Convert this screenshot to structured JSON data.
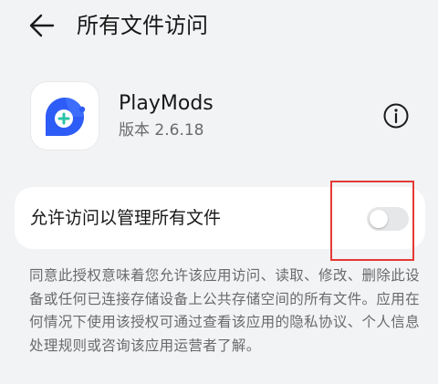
{
  "header": {
    "title": "所有文件访问",
    "back_icon": "arrow-left-icon"
  },
  "app": {
    "name": "PlayMods",
    "version": "版本 2.6.18",
    "icon": "playmods-logo",
    "info_icon": "info-circle-icon"
  },
  "setting": {
    "label": "允许访问以管理所有文件",
    "enabled": false
  },
  "description": "同意此授权意味着您允许该应用访问、读取、修改、删除此设备或任何已连接存储设备上公共存储空间的所有文件。应用在何情况下使用该授权可通过查看该应用的隐私协议、个人信息处理规则或咨询该应用运营者了解。",
  "colors": {
    "background": "#f1f3f5",
    "card": "#ffffff",
    "toggle_off": "#e6e7e9",
    "highlight": "#e53935",
    "logo_blue": "#2e5cf6"
  }
}
